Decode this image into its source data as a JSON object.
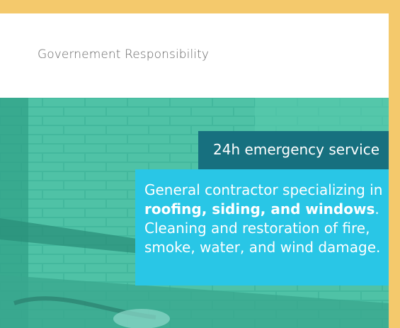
{
  "header": {
    "title": "Governement Responsibility"
  },
  "hero": {
    "badge": "24h emergency service",
    "description": {
      "intro": "General contractor specializing in ",
      "highlight": "roofing, siding, and windows",
      "outro": ". Cleaning and restoration of fire, smoke, water, and wind damage."
    }
  },
  "colors": {
    "frame": "#f4c96c",
    "hero_overlay": "#3bb39b",
    "badge": "#17707f",
    "description": "#29c6e6"
  }
}
